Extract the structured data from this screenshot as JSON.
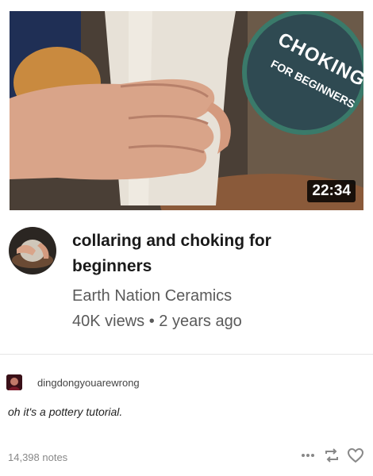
{
  "video": {
    "duration": "22:34",
    "badge_line1": "CHOKING",
    "badge_line2": "FOR BEGINNERS",
    "title": "collaring and choking for beginners",
    "channel": "Earth Nation Ceramics",
    "views": "40K views",
    "separator": "•",
    "age": "2 years ago"
  },
  "post": {
    "username": "dingdongyouarewrong",
    "comment": "oh it's a pottery tutorial.",
    "notes": "14,398 notes"
  },
  "actions": {
    "more_icon": "more-icon",
    "reblog_icon": "reblog-icon",
    "like_icon": "heart-icon"
  },
  "colors": {
    "badge_ring": "#3a7a6a",
    "badge_fill": "#2f4a52",
    "clay": "#e8e2d8",
    "text_muted": "#5a5a5a"
  }
}
